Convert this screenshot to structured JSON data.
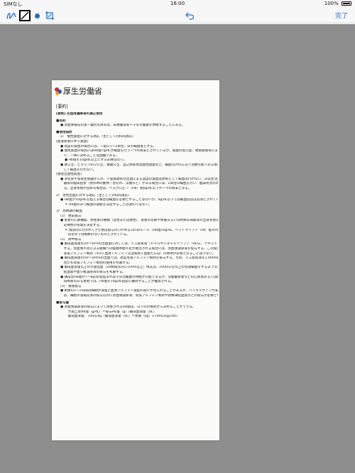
{
  "status_bar": {
    "carrier": "SIMなし",
    "time": "16:00",
    "battery": "100%"
  },
  "toolbar": {
    "tools": [
      "scribble-icon",
      "frame-icon",
      "color-dot",
      "crop-icon"
    ],
    "accent_color": "#1c6fd1",
    "undo_icon": "undo-icon",
    "done_label": "完了"
  },
  "document": {
    "logo_title": "厚生労働省",
    "logo_subtitle": "Ministry of Health, Labour and Welfare",
    "section_label": "[要約]",
    "lines": [
      {
        "cls": "heading",
        "text": "[要約] 赤血球濃厚液の適正使用"
      },
      {
        "cls": "heading gap",
        "text": "■目的"
      },
      {
        "cls": "i1",
        "text": "● 赤血球補充の第一義的な目的は、末梢循環系へ十分な酸素を供給することにある。"
      },
      {
        "cls": "heading gap",
        "text": "■使用指針"
      },
      {
        "cls": "i1",
        "text": "1)　慢性貧血に対する適応（主として内科的適応）"
      },
      {
        "cls": "",
        "text": "[血液疾患に伴う貧血]"
      },
      {
        "cls": "i1",
        "text": "● 高度の貧血の場合には、一般に1〜2単位／日の輸血量とする。"
      },
      {
        "cls": "i1",
        "text": "● 慢性貧血の場合にはHb値7g/dLが輸血を行う一つの目安とされているが、貧血の進行度、罹患期間等により必要量が異な"
      },
      {
        "cls": "i1",
        "text": "　り、一律に決めることは困難である。"
      },
      {
        "cls": "i2",
        "text": "● Hb値を10g/dL以上にする必要はない。"
      },
      {
        "cls": "i1",
        "text": "● 鉄欠乏、ビタミンB12欠乏、葉酸欠乏、自己免疫性溶血性貧血など、輸血以外の方法で治療可能である疾患には、原則と"
      },
      {
        "cls": "i1",
        "text": "　して輸血を行わない。"
      },
      {
        "cls": "",
        "text": "[慢性出血性貧血]"
      },
      {
        "cls": "i1",
        "text": "● 消化管や泌尿生殖器からの、少量長期的な出血による高度の貧血は原則として輸血は行わない。日常生活に支障を来す循環"
      },
      {
        "cls": "i1",
        "text": "　器系の臨床症状（労作時の動悸・息切れ、浮腫など）がある場合には、2単位の輸血を行い、臨床所見の改善の程度を観察す"
      },
      {
        "cls": "i1",
        "text": "　る。全身状態が良好な場合は、ヘモグロビン（Hb）値6g/dL以下が一つの目安となる。"
      },
      {
        "cls": "gap",
        "text": "2)　急性出血に対する適応（主として外科的適応）"
      },
      {
        "cls": "i1",
        "text": "● Hb値が10g/dLを超える場合は輸血を必要とすることはないが、6g/dL以下では輸血はほぼ必須とされている。"
      },
      {
        "cls": "i2",
        "text": "＊ Hb値のみで輸血の開始を決定することは適切ではない。"
      },
      {
        "cls": "gap",
        "text": "3)　周術期の輸血"
      },
      {
        "cls": "i1",
        "text": "(1)　術前投与"
      },
      {
        "cls": "i1",
        "text": "● 患者の心肺機能、原疾患の種類（良性または悪性）、患者の年齢や体重あるいは特殊な病態等の全身状態を把握して投与の"
      },
      {
        "cls": "i1",
        "text": "　必要性の有無を決定する。"
      },
      {
        "cls": "i2",
        "text": "＊ 慣習的に行われてきた術前投与のいわゆる10/30ルール（Hb値10g/dL、ヘマトクリット（Ht）値30%以上にすることと"
      },
      {
        "cls": "i2",
        "text": "　は近年では根拠のないものとされている。"
      },
      {
        "cls": "i1",
        "text": "(2)　術中投与"
      },
      {
        "cls": "i1",
        "text": "● 循環血液量の20〜50%の出血量に対しては、人工膠質液（ヒドロキシエチルデンプン（HES）、デキストランなど）を投与"
      },
      {
        "cls": "i1",
        "text": "　する。赤血球不足による組織への酸素供給不足が懸念される場合には、赤血球濃厚液を投与する。この程度までの出血では、"
      },
      {
        "cls": "i1",
        "text": "　等張アルブミン製剤（5%人血清アルブミン又は加熱人血漿たん白）の併用が必要となることは少ない。"
      },
      {
        "cls": "i1",
        "text": "● 循環血液量の50〜100%の出血では、適宜等張アルブミン製剤を投与する。なお、人工膠質液を1,000mL以上必要とする場"
      },
      {
        "cls": "i1",
        "text": "　合にも等張アルブミン製剤の使用を考慮する。"
      },
      {
        "cls": "i1",
        "text": "● 循環血液量以上の大量出血（24時間以内に100%以上）時又は、100mL/分以上の急速輸血をするような事態には、新鮮凍"
      },
      {
        "cls": "i1",
        "text": "　結血漿や血小板濃厚液の投与も考慮する。"
      },
      {
        "cls": "i1",
        "text": "● 通常はHb値が7〜8g/dL程度あれば十分な酸素の供給が可能であるが、冠動脈疾患などの心疾患あるいは肺機能障害や脳循"
      },
      {
        "cls": "i1",
        "text": "　環障害のある患者では、Hb値を10g/dL程度に維持することが推奨される。"
      },
      {
        "cls": "i1",
        "text": "(3)　術後投与"
      },
      {
        "cls": "i1",
        "text": "● 術後の1〜2日間は細胞外液量と血清アルブミン濃度の減少が見られることがあるが、バイタルサインが安定している場合"
      },
      {
        "cls": "i1",
        "text": "　は、細胞外液補充液の投与以外に赤血球濃厚液、等張アルブミン製剤や新鮮凍結血漿などの投与が必要となる場合は少ない。"
      },
      {
        "cls": "heading gap",
        "text": "■投与量"
      },
      {
        "cls": "i1",
        "text": "● 赤血球濃厚液の投与によって改善されるHb値は、以下の計算式から求めることができる。"
      },
      {
        "cls": "i2",
        "text": "　予測上昇Hb値（g/dL）＝投与Hb量（g）/循環血液量（dL）"
      },
      {
        "cls": "i2",
        "text": "　循環血液量：70mL/kg（循環血液量（dL）＝体重（kg）×70mL/kg/100）"
      }
    ]
  }
}
